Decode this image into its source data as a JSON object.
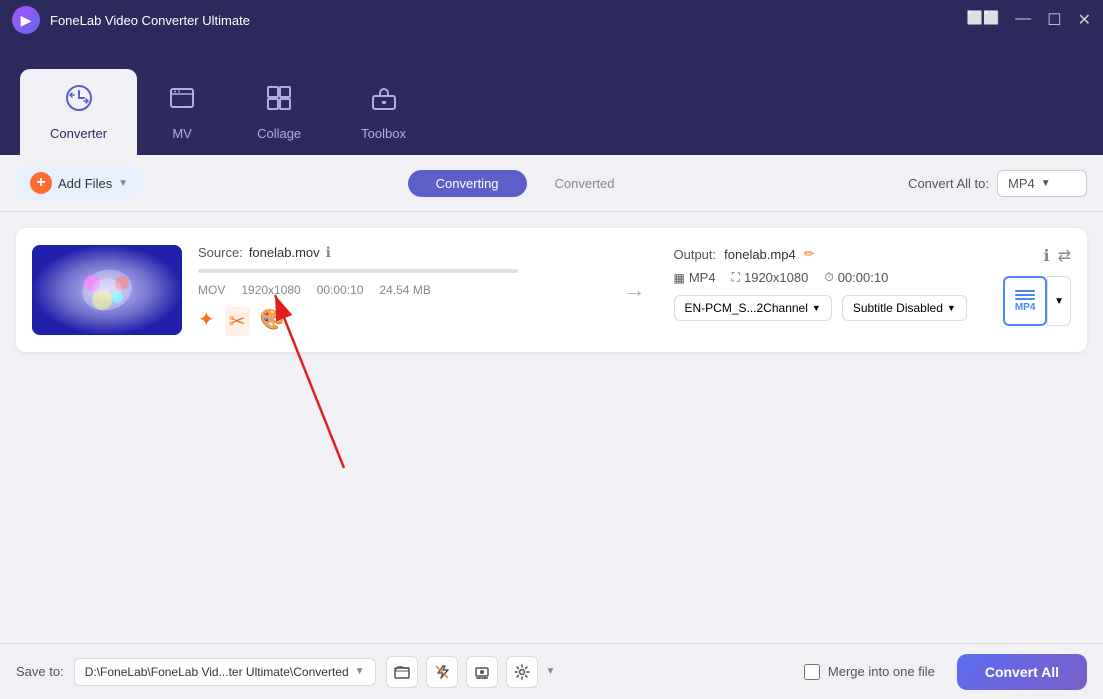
{
  "app": {
    "title": "FoneLab Video Converter Ultimate",
    "logo": "▶"
  },
  "titlebar": {
    "controls": [
      "⬜",
      "—",
      "⬜",
      "✕"
    ]
  },
  "nav": {
    "tabs": [
      {
        "id": "converter",
        "label": "Converter",
        "icon": "↻",
        "active": true
      },
      {
        "id": "mv",
        "label": "MV",
        "icon": "📺"
      },
      {
        "id": "collage",
        "label": "Collage",
        "icon": "⊞"
      },
      {
        "id": "toolbox",
        "label": "Toolbox",
        "icon": "🧰"
      }
    ]
  },
  "toolbar": {
    "add_files_label": "Add Files",
    "converting_tab": "Converting",
    "converted_tab": "Converted",
    "convert_all_to_label": "Convert All to:",
    "format_value": "MP4"
  },
  "file_item": {
    "source_label": "Source:",
    "source_file": "fonelab.mov",
    "format": "MOV",
    "resolution": "1920x1080",
    "duration": "00:00:10",
    "size": "24.54 MB",
    "output_label": "Output:",
    "output_file": "fonelab.mp4",
    "output_format": "MP4",
    "output_resolution": "1920x1080",
    "output_duration": "00:00:10",
    "audio_channel": "EN-PCM_S...2Channel",
    "subtitle": "Subtitle Disabled"
  },
  "bottom": {
    "save_to_label": "Save to:",
    "save_path": "D:\\FoneLab\\FoneLab Vid...ter Ultimate\\Converted",
    "merge_label": "Merge into one file",
    "convert_all_label": "Convert All"
  }
}
